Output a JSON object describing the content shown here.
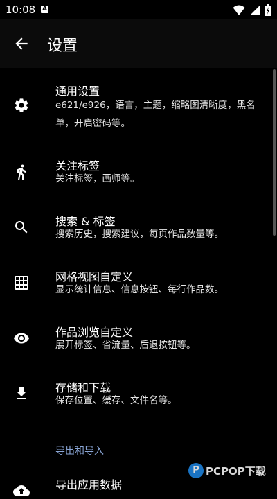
{
  "status": {
    "time": "10:08",
    "badge": "A"
  },
  "appbar": {
    "title": "设置"
  },
  "items": [
    {
      "title": "通用设置",
      "subtitle": "e621/e926，语言，主题，缩略图清晰度，黑名单，开启密码等。"
    },
    {
      "title": "关注标签",
      "subtitle": "关注标签，画师等。"
    },
    {
      "title": "搜索 & 标签",
      "subtitle": "搜索历史，搜索建议，每页作品数量等。"
    },
    {
      "title": "网格视图自定义",
      "subtitle": "显示统计信息、信息按钮、每行作品数。"
    },
    {
      "title": "作品浏览自定义",
      "subtitle": "展开标签、省流量、后退按钮等。"
    },
    {
      "title": "存储和下载",
      "subtitle": "保存位置、缓存、文件名等。"
    }
  ],
  "section": {
    "title": "导出和导入"
  },
  "export_item": {
    "title": "导出应用数据"
  },
  "watermark": {
    "text": "PCPOP下载"
  }
}
